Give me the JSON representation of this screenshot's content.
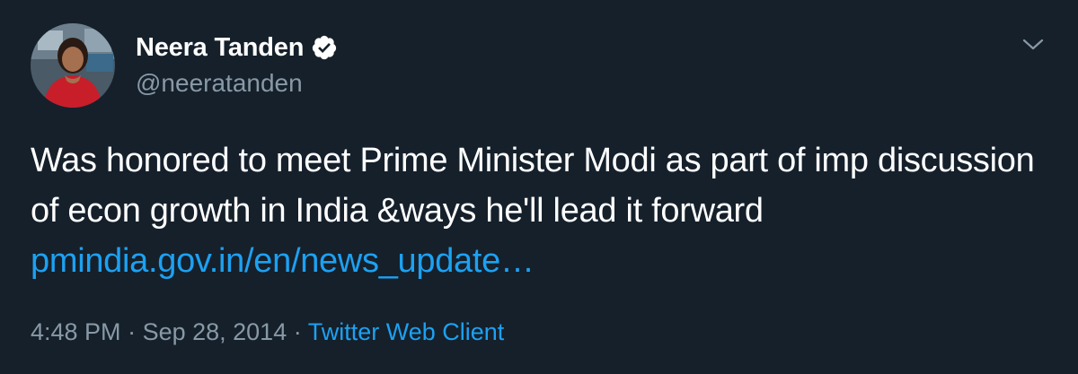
{
  "user": {
    "display_name": "Neera Tanden",
    "handle": "@neeratanden",
    "verified": true
  },
  "tweet": {
    "text_before_link": "Was honored to meet Prime Minister Modi as part of imp discussion of econ growth in India &ways he'll lead it forward ",
    "link_text": "pmindia.gov.in/en/news_update…"
  },
  "meta": {
    "time": "4:48 PM",
    "separator": " · ",
    "date": "Sep 28, 2014",
    "client": "Twitter Web Client"
  },
  "icons": {
    "verified": "verified-badge-icon",
    "menu": "chevron-down-icon"
  },
  "colors": {
    "background": "#15202b",
    "text": "#ffffff",
    "secondary": "#8899a6",
    "accent": "#1da1f2"
  }
}
